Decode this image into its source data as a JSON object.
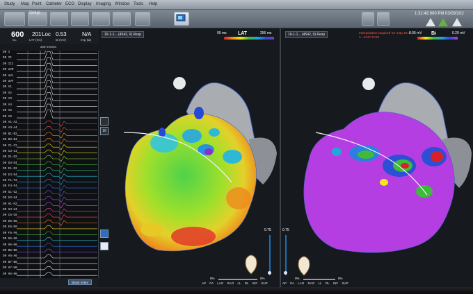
{
  "menu": {
    "items": [
      "Study",
      "Map",
      "Point",
      "Catheter",
      "ECG",
      "Display",
      "Imaging",
      "Window",
      "Tools",
      "Help"
    ]
  },
  "toolbar": {
    "setup_label": "Setup"
  },
  "status": {
    "time": "1:32:49.900 PM",
    "date": "03/09/202"
  },
  "ecg": {
    "cl_value": "600",
    "cl_label": "CL",
    "lat_value": "201",
    "lat_label": "LAT (ms)",
    "loc_label": "Loc",
    "bi_value": "0.53",
    "bi_label": "Bi (mV)",
    "imp_value": "N/A",
    "imp_label": "Imp (Ω)",
    "ruler_label": "200 mmsec",
    "channels": [
      "DR I",
      "DR II",
      "DR III",
      "DR aVR",
      "DR aVL",
      "DR aVF",
      "DR V1",
      "DR V2",
      "DR V3",
      "DR V4",
      "DR V5",
      "DR V6",
      "DR A1-A2",
      "DR A3-A4",
      "DR B1-B2",
      "DR B3-B4",
      "DR C1-C2",
      "DR C3-C4",
      "DR D1-D2",
      "DR D3-D4",
      "DR E1-E2",
      "DR E3-E4",
      "DR F1-F2",
      "DR F3-F4",
      "DR G1-G2",
      "DR G3-G4",
      "DR H1-H2",
      "DR H3-H4",
      "DR C5-C6",
      "DR D5-D6",
      "DR E5-E6",
      "DR F5-F6",
      "DR G5-G6",
      "DR H5-H6",
      "DR B5-B6",
      "DR A5-A6",
      "DR B7-B8",
      "DR H7-H8",
      "DR H5-H6"
    ],
    "footer_button": "Blank Index"
  },
  "map_left": {
    "title": "16-1-1... (4542, 0) Resp",
    "scale_min": "90 ms",
    "scale_type": "LAT",
    "scale_max": "256 ms",
    "side_number": "16",
    "bottom_value": "0.75",
    "opacity_pct_left": "0%",
    "opacity_pct_right": "0%",
    "views": [
      "AP",
      "PA",
      "LAO",
      "RAO",
      "LL",
      "RL",
      "INF",
      "SUP"
    ]
  },
  "map_right": {
    "title": "16-1-1... (4542, 0) Resp",
    "warning": "Interpolation required for map 16-1-1...ColV PASt",
    "scale_min": "0.05 mV",
    "scale_type": "Bi",
    "scale_max": "0.20 mV",
    "bottom_value": "0.75",
    "opacity_pct_left": "0%",
    "opacity_pct_right": "0%",
    "views": [
      "AP",
      "PA",
      "LAO",
      "RAO",
      "LL",
      "RL",
      "INF",
      "SUP"
    ]
  },
  "colors": {
    "lat_gradient": [
      "#d8202a",
      "#f28a16",
      "#f4e61b",
      "#3fbb3b",
      "#20a8d8",
      "#2c4fd6",
      "#8b2fc9"
    ],
    "bipolar_gradient": [
      "#d8202a",
      "#f4e61b",
      "#3fbb3b",
      "#20a8d8",
      "#2c4fd6",
      "#b43ee2"
    ]
  }
}
